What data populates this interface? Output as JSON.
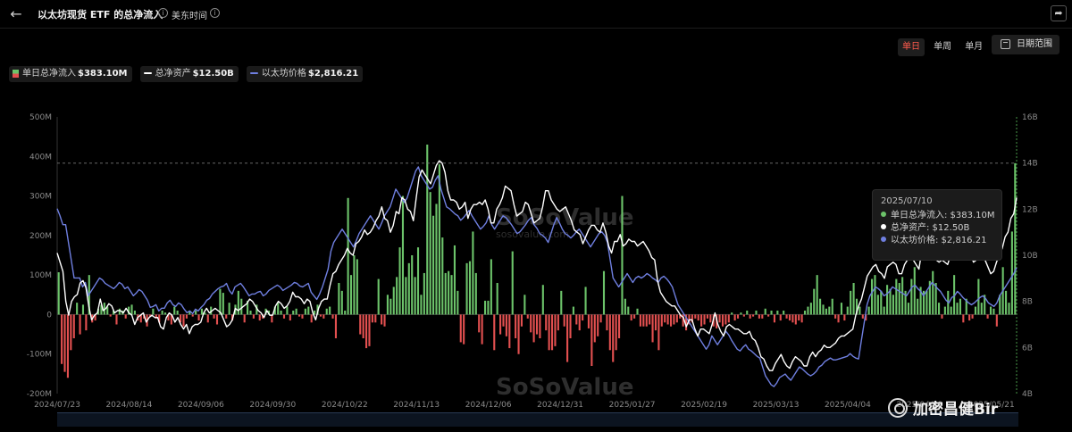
{
  "header": {
    "title": "以太坊现货 ETF 的总净流入",
    "timezone": "美东时间",
    "back_icon": "arrow-left-icon",
    "share_icon": "share-icon"
  },
  "range": {
    "options": [
      "单日",
      "单周",
      "单月"
    ],
    "active": "单日",
    "date_button": "日期范围"
  },
  "legend": [
    {
      "label": "单日总净流入",
      "value": "$383.10M",
      "swatch": "bar"
    },
    {
      "label": "总净资产",
      "value": "$12.50B",
      "swatch": "#ffffff"
    },
    {
      "label": "以太坊价格",
      "value": "$2,816.21",
      "swatch": "#6f7fe0"
    }
  ],
  "tooltip": {
    "date": "2025/07/10",
    "rows": [
      {
        "text": "单日总净流入: $383.10M",
        "color": "#6cc36a"
      },
      {
        "text": "总净资产: $12.50B",
        "color": "#ffffff"
      },
      {
        "text": "以太坊价格: $2,816.21",
        "color": "#6f7fe0"
      }
    ]
  },
  "watermark_text": "SoSoValue",
  "watermark_sub": "sosovalue.com",
  "source_watermark": "加密昌健Bir",
  "colors": {
    "positive": "#6cc36a",
    "negative": "#e35050",
    "assets": "#ffffff",
    "price": "#6f7fe0"
  },
  "chart_data": {
    "type": "bar",
    "title": "",
    "x_ticks": [
      "2024/07/23",
      "2024/08/14",
      "2024/09/06",
      "2024/09/30",
      "2024/10/22",
      "2024/11/13",
      "2024/12/06",
      "2024/12/31",
      "2025/01/27",
      "2025/02/19",
      "2025/03/13",
      "2025/04/04",
      "2025/04/29",
      "2025/05/21"
    ],
    "left_axis": {
      "ticks": [
        "500M",
        "400M",
        "300M",
        "200M",
        "100M",
        "0",
        "-100M",
        "-200M"
      ],
      "ylim": [
        -200,
        500
      ],
      "unit": "M USD"
    },
    "right_axis": {
      "ticks": [
        "16B",
        "14B",
        "12B",
        "10B",
        "8B",
        "6B",
        "4B"
      ],
      "ylim": [
        4,
        16
      ],
      "unit": "B USD"
    },
    "grid": false,
    "series": [
      {
        "name": "单日总净流入",
        "kind": "bar",
        "values": [
          107,
          -125,
          -145,
          -160,
          -90,
          -60,
          30,
          -50,
          25,
          -40,
          100,
          -20,
          -15,
          15,
          25,
          30,
          20,
          -5,
          10,
          -25,
          15,
          10,
          -10,
          20,
          25,
          10,
          -15,
          -20,
          -10,
          -30,
          -5,
          15,
          -10,
          -20,
          10,
          5,
          -15,
          -25,
          20,
          10,
          -20,
          -30,
          -10,
          10,
          -5,
          10,
          -15,
          15,
          5,
          -20,
          20,
          -10,
          -25,
          65,
          55,
          -10,
          30,
          -15,
          25,
          60,
          40,
          -20,
          35,
          10,
          -10,
          25,
          -15,
          -10,
          15,
          10,
          -20,
          20,
          30,
          10,
          -10,
          20,
          -15,
          10,
          15,
          -5,
          -10,
          15,
          20,
          -20,
          10,
          25,
          -5,
          -10,
          15,
          20,
          -10,
          -60,
          80,
          60,
          10,
          295,
          100,
          150,
          140,
          -50,
          -60,
          -85,
          -80,
          -20,
          -20,
          90,
          -25,
          -30,
          50,
          40,
          70,
          95,
          170,
          300,
          95,
          130,
          150,
          95,
          170,
          50,
          105,
          430,
          310,
          250,
          280,
          380,
          195,
          105,
          110,
          100,
          175,
          60,
          -70,
          -75,
          130,
          135,
          210,
          105,
          -45,
          -75,
          35,
          35,
          140,
          -90,
          80,
          -50,
          -30,
          -55,
          -85,
          160,
          -60,
          -100,
          -30,
          50,
          -10,
          -45,
          -70,
          -50,
          -60,
          75,
          -40,
          -90,
          -90,
          -80,
          -40,
          60,
          -30,
          -120,
          -60,
          20,
          -25,
          -40,
          -15,
          70,
          -35,
          -130,
          -70,
          -55,
          -20,
          110,
          -40,
          -90,
          -120,
          -90,
          -60,
          300,
          40,
          20,
          -15,
          -10,
          15,
          -30,
          -30,
          -30,
          -25,
          -70,
          -40,
          -90,
          -30,
          -20,
          -25,
          -30,
          -25,
          -20,
          -10,
          -30,
          -40,
          -25,
          -20,
          -10,
          -15,
          -30,
          -25,
          -10,
          -20,
          -30,
          -35,
          -20,
          -30,
          -25,
          -20,
          5,
          -15,
          -10,
          5,
          -5,
          10,
          -10,
          -5,
          10,
          -10,
          -10,
          15,
          -5,
          10,
          -20,
          10,
          -15,
          10,
          -10,
          -15,
          -20,
          -25,
          -15,
          -20,
          10,
          20,
          30,
          65,
          100,
          40,
          25,
          15,
          20,
          40,
          -10,
          -20,
          30,
          -15,
          20,
          60,
          80,
          40,
          20,
          -10,
          -15,
          20,
          90,
          100,
          50,
          60,
          20,
          75,
          65,
          50,
          90,
          80,
          95,
          60,
          30,
          90,
          120,
          40,
          70,
          60,
          60,
          85,
          110,
          80,
          30,
          -10,
          20,
          60,
          20,
          100,
          30,
          40,
          -20,
          40,
          -15,
          -10,
          20,
          90,
          30,
          50,
          -10,
          20,
          15,
          -30,
          50,
          120,
          60,
          30,
          210,
          383
        ]
      },
      {
        "name": "总净资产",
        "kind": "line",
        "values": [
          10.1,
          9.7,
          9.3,
          8.0,
          7.4,
          8.0,
          8.2,
          8.3,
          8.8,
          8.9,
          8.6,
          7.8,
          7.2,
          7.4,
          7.5,
          8.1,
          7.6,
          7.7,
          7.9,
          7.8,
          7.5,
          7.6,
          7.6,
          7.5,
          7.7,
          7.5,
          7.4,
          7.0,
          7.3,
          7.4,
          7.5,
          7.1,
          7.3,
          7.4,
          7.3,
          7.3,
          6.9,
          6.8,
          7.3,
          7.5,
          7.4,
          7.1,
          7.3,
          7.0,
          6.8,
          7.0,
          6.6,
          6.9,
          7.0,
          7.0,
          7.1,
          7.5,
          7.7,
          7.5,
          7.6,
          7.7,
          7.6,
          7.5,
          7.2,
          6.9,
          7.0,
          7.2,
          7.7,
          7.6,
          7.7,
          7.8,
          7.9,
          8.1,
          8.0,
          7.8,
          7.6,
          7.5,
          7.3,
          7.6,
          7.4,
          7.4,
          7.8,
          8.0,
          7.9,
          7.7,
          7.8,
          8.0,
          8.4,
          8.2,
          8.2,
          8.1,
          7.9,
          8.1,
          8.0,
          7.5,
          7.2,
          7.7,
          8.0,
          8.1,
          8.1,
          8.7,
          9.2,
          9.3,
          9.6,
          9.8,
          10.0,
          10.3,
          10.1,
          10.0,
          10.5,
          10.6,
          10.8,
          11.1,
          10.9,
          11.0,
          11.2,
          11.5,
          11.7,
          12.1,
          11.6,
          11.5,
          11.0,
          11.3,
          11.9,
          11.8,
          12.5,
          12.4,
          12.0,
          11.9,
          11.5,
          12.5,
          13.4,
          13.7,
          13.5,
          13.3,
          13.1,
          13.5,
          13.9,
          14.1,
          14.0,
          13.6,
          12.8,
          12.4,
          12.4,
          12.3,
          12.0,
          12.1,
          12.3,
          11.6,
          12.0,
          12.2,
          12.2,
          12.3,
          12.2,
          12.4,
          12.0,
          11.4,
          11.4,
          12.0,
          12.2,
          12.5,
          13.0,
          12.9,
          12.8,
          12.2,
          11.7,
          11.8,
          11.9,
          12.3,
          12.2,
          11.8,
          11.4,
          11.5,
          11.6,
          12.1,
          12.8,
          12.8,
          12.4,
          12.2,
          12.0,
          11.9,
          12.0,
          12.1,
          11.8,
          11.5,
          11.1,
          11.0,
          10.9,
          10.5,
          10.8,
          11.1,
          11.3,
          11.3,
          11.1,
          11.0,
          11.4,
          11.0,
          10.4,
          10.1,
          10.6,
          10.6,
          10.9,
          10.4,
          10.5,
          10.7,
          10.6,
          10.6,
          10.4,
          10.5,
          10.6,
          10.4,
          10.2,
          9.9,
          9.8,
          8.9,
          8.4,
          8.2,
          8.0,
          7.9,
          7.8,
          7.8,
          7.6,
          7.4,
          7.3,
          6.9,
          7.2,
          7.2,
          6.8,
          6.5,
          6.8,
          6.8,
          6.7,
          6.6,
          7.0,
          7.5,
          7.0,
          6.7,
          6.5,
          6.9,
          7.0,
          6.9,
          6.8,
          6.8,
          6.7,
          6.6,
          6.6,
          6.7,
          6.4,
          6.3,
          6.0,
          5.6,
          5.5,
          5.2,
          5.0,
          5.0,
          5.3,
          5.5,
          5.7,
          5.4,
          5.2,
          5.1,
          5.4,
          5.6,
          5.5,
          5.4,
          5.2,
          5.2,
          5.6,
          5.8,
          5.6,
          5.8,
          5.9,
          6.1,
          6.0,
          6.0,
          6.1,
          6.2,
          6.4,
          6.5,
          6.5,
          6.6,
          6.7,
          6.8,
          7.4,
          7.8,
          8.1,
          8.6,
          9.1,
          9.3,
          9.5,
          9.6,
          9.3,
          9.2,
          9.0,
          9.5,
          9.6,
          9.7,
          9.6,
          9.2,
          9.2,
          9.6,
          9.8,
          10.0,
          9.8,
          9.6,
          9.4,
          10.2,
          10.5,
          10.7,
          10.3,
          10.1,
          9.8,
          9.7,
          9.8,
          9.7,
          9.6,
          10.0,
          10.6,
          11.0,
          10.7,
          10.2,
          9.8,
          9.9,
          10.0,
          9.7,
          9.8,
          10.3,
          10.2,
          9.8,
          9.5,
          9.2,
          9.3,
          9.7,
          10.0,
          10.3,
          10.8,
          11.0,
          11.6,
          11.8,
          12.5
        ]
      },
      {
        "name": "以太坊价格",
        "kind": "line",
        "values": [
          3480,
          3400,
          3300,
          3300,
          3100,
          2900,
          2700,
          2700,
          2700,
          2600,
          2650,
          2500,
          2550,
          2600,
          2650,
          2700,
          2680,
          2640,
          2620,
          2600,
          2580,
          2610,
          2650,
          2630,
          2580,
          2600,
          2550,
          2500,
          2530,
          2570,
          2550,
          2500,
          2450,
          2370,
          2380,
          2400,
          2330,
          2360,
          2360,
          2420,
          2450,
          2400,
          2380,
          2420,
          2400,
          2350,
          2310,
          2330,
          2300,
          2350,
          2330,
          2370,
          2400,
          2450,
          2470,
          2520,
          2550,
          2580,
          2600,
          2610,
          2640,
          2560,
          2520,
          2600,
          2620,
          2640,
          2600,
          2550,
          2500,
          2520,
          2520,
          2540,
          2550,
          2500,
          2520,
          2560,
          2580,
          2600,
          2620,
          2600,
          2560,
          2580,
          2600,
          2620,
          2650,
          2640,
          2610,
          2600,
          2620,
          2640,
          2540,
          2500,
          2460,
          2520,
          2600,
          2700,
          2800,
          3000,
          3100,
          3150,
          3200,
          3250,
          3200,
          3150,
          3100,
          3050,
          3120,
          3200,
          3250,
          3300,
          3350,
          3400,
          3350,
          3300,
          3250,
          3320,
          3400,
          3450,
          3500,
          3600,
          3700,
          3650,
          3600,
          3550,
          3600,
          3700,
          3800,
          3900,
          3950,
          3850,
          3800,
          3750,
          3700,
          3720,
          3800,
          3850,
          3700,
          3600,
          3500,
          3480,
          3450,
          3420,
          3400,
          3350,
          3380,
          3420,
          3460,
          3400,
          3350,
          3300,
          3250,
          3280,
          3320,
          3400,
          3300,
          3250,
          3300,
          3350,
          3400,
          3380,
          3340,
          3300,
          3250,
          3200,
          3220,
          3260,
          3300,
          3350,
          3380,
          3300,
          3260,
          3200,
          3180,
          3150,
          3100,
          3200,
          3300,
          3380,
          3320,
          3250,
          3200,
          3180,
          3150,
          3180,
          3220,
          3250,
          3200,
          3150,
          3100,
          3050,
          3100,
          3150,
          3200,
          3220,
          3180,
          3100,
          2900,
          2700,
          2650,
          2600,
          2650,
          2700,
          2750,
          2700,
          2650,
          2700,
          2720,
          2700,
          2720,
          2750,
          2730,
          2700,
          2680,
          2650,
          2700,
          2720,
          2690,
          2650,
          2600,
          2500,
          2400,
          2350,
          2300,
          2250,
          2200,
          2150,
          2100,
          2050,
          2000,
          1950,
          1900,
          1950,
          2050,
          2000,
          1950,
          2000,
          2050,
          2100,
          2060,
          2000,
          1950,
          1900,
          1880,
          1920,
          1950,
          1900,
          1880,
          1850,
          1820,
          1800,
          1700,
          1600,
          1550,
          1500,
          1480,
          1520,
          1580,
          1600,
          1620,
          1580,
          1550,
          1600,
          1650,
          1700,
          1680,
          1650,
          1620,
          1600,
          1620,
          1650,
          1700,
          1720,
          1760,
          1780,
          1800,
          1780,
          1780,
          1790,
          1800,
          1810,
          1820,
          1850,
          1820,
          1800,
          1790,
          2000,
          2200,
          2400,
          2500,
          2550,
          2600,
          2580,
          2550,
          2500,
          2520,
          2550,
          2600,
          2580,
          2560,
          2540,
          2520,
          2500,
          2550,
          2600,
          2620,
          2580,
          2550,
          2500,
          2550,
          2600,
          2650,
          2620,
          2580,
          2550,
          2500,
          2450,
          2420,
          2480,
          2500,
          2550,
          2520,
          2480,
          2450,
          2420,
          2400,
          2420,
          2450,
          2480,
          2500,
          2470,
          2420,
          2400,
          2380,
          2420,
          2500,
          2550,
          2600,
          2650,
          2700,
          2750,
          2816
        ]
      }
    ]
  }
}
